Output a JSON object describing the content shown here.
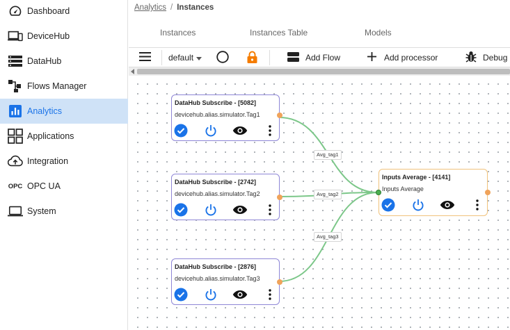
{
  "sidebar": {
    "items": [
      {
        "label": "Dashboard",
        "icon": "dashboard-icon",
        "active": false
      },
      {
        "label": "DeviceHub",
        "icon": "devices-icon",
        "active": false
      },
      {
        "label": "DataHub",
        "icon": "storage-icon",
        "active": false
      },
      {
        "label": "Flows Manager",
        "icon": "flow-icon",
        "active": false
      },
      {
        "label": "Analytics",
        "icon": "analytics-icon",
        "active": true
      },
      {
        "label": "Applications",
        "icon": "apps-icon",
        "active": false
      },
      {
        "label": "Integration",
        "icon": "cloud-upload-icon",
        "active": false
      },
      {
        "label": "OPC UA",
        "icon": "opc-icon",
        "active": false
      },
      {
        "label": "System",
        "icon": "laptop-icon",
        "active": false
      }
    ],
    "opc_text": "OPC"
  },
  "breadcrumb": {
    "parent": "Analytics",
    "separator": "/",
    "current": "Instances"
  },
  "tabs": [
    "Instances",
    "Instances Table",
    "Models"
  ],
  "toolbar": {
    "flow_select": "default",
    "add_flow": "Add Flow",
    "add_processor": "Add processor",
    "debug": "Debug"
  },
  "colors": {
    "accent": "#1a73e8",
    "active_bg": "#cfe2f7",
    "subscriber_border": "#8e86d6",
    "processor_border": "#f0c27c",
    "wire": "#7cc789",
    "port_out": "#f0a35a",
    "lock": "#f57c00"
  },
  "nodes": [
    {
      "title": "DataHub Subscribe - [5082]",
      "subtitle": "devicehub.alias.simulator.Tag1"
    },
    {
      "title": "DataHub Subscribe - [2742]",
      "subtitle": "devicehub.alias.simulator.Tag2"
    },
    {
      "title": "DataHub Subscribe - [2876]",
      "subtitle": "devicehub.alias.simulator.Tag3"
    },
    {
      "title": "Inputs Average - [4141]",
      "subtitle": "Inputs Average"
    }
  ],
  "wires": [
    {
      "label": "Avg_tag1"
    },
    {
      "label": "Avg_tag2"
    },
    {
      "label": "Avg_tag3"
    }
  ]
}
